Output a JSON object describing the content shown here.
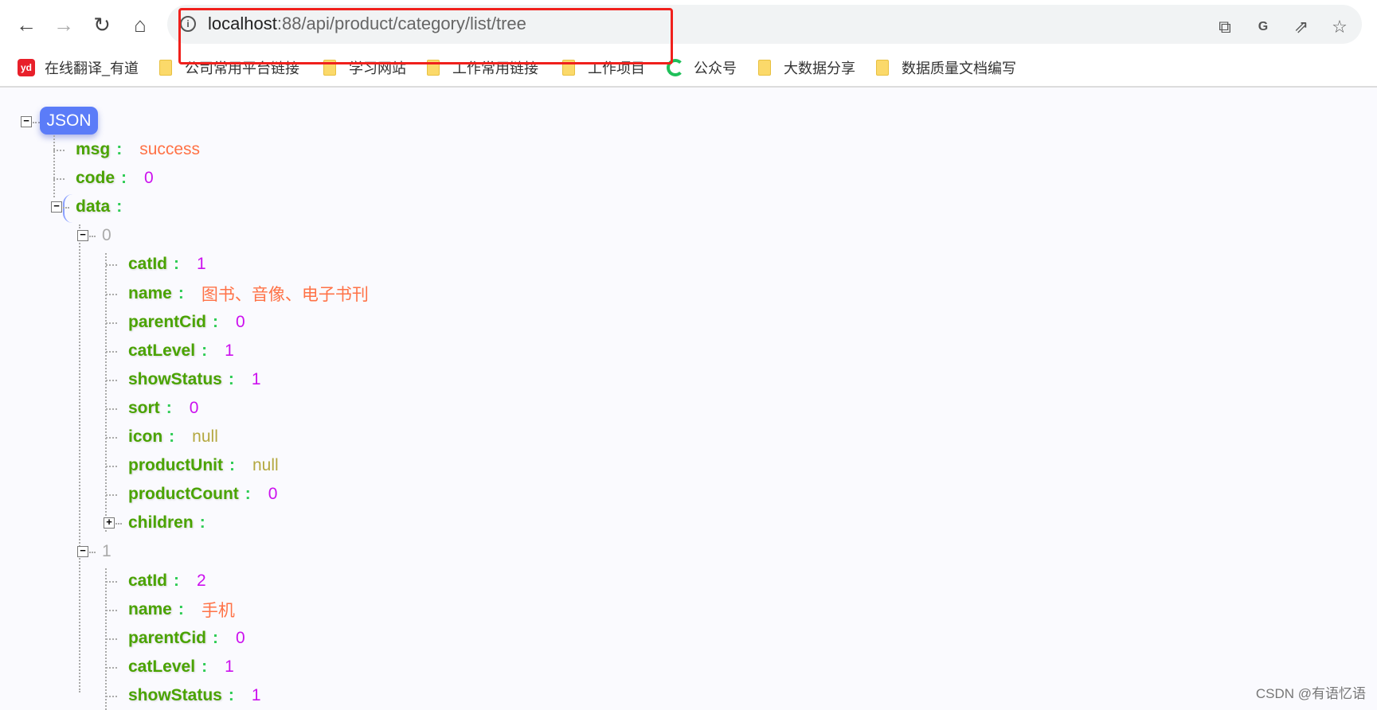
{
  "browser": {
    "url_host": "localhost",
    "url_path": ":88/api/product/category/list/tree",
    "bookmarks": [
      {
        "label": "在线翻译_有道",
        "icon": "youdao-icon"
      },
      {
        "label": "公司常用平台链接",
        "icon": "folder-icon"
      },
      {
        "label": "学习网站",
        "icon": "folder-icon"
      },
      {
        "label": "工作常用链接",
        "icon": "folder-icon"
      },
      {
        "label": "工作项目",
        "icon": "folder-icon"
      },
      {
        "label": "公众号",
        "icon": "wechat-icon"
      },
      {
        "label": "大数据分享",
        "icon": "folder-icon"
      },
      {
        "label": "数据质量文档编写",
        "icon": "folder-icon"
      }
    ]
  },
  "viewer": {
    "root_label": "JSON",
    "rows": [
      {
        "key": "msg",
        "value": "success",
        "type": "string",
        "depth": 0
      },
      {
        "key": "code",
        "value": "0",
        "type": "number",
        "depth": 0
      },
      {
        "key": "data",
        "value": "",
        "type": "object",
        "depth": 0,
        "toggle": "minus"
      },
      {
        "key": "0",
        "value": "",
        "type": "index",
        "depth": 1,
        "toggle": "minus"
      },
      {
        "key": "catId",
        "value": "1",
        "type": "number",
        "depth": 2
      },
      {
        "key": "name",
        "value": "图书、音像、电子书刊",
        "type": "string",
        "depth": 2
      },
      {
        "key": "parentCid",
        "value": "0",
        "type": "number",
        "depth": 2
      },
      {
        "key": "catLevel",
        "value": "1",
        "type": "number",
        "depth": 2
      },
      {
        "key": "showStatus",
        "value": "1",
        "type": "number",
        "depth": 2
      },
      {
        "key": "sort",
        "value": "0",
        "type": "number",
        "depth": 2
      },
      {
        "key": "icon",
        "value": "null",
        "type": "null",
        "depth": 2
      },
      {
        "key": "productUnit",
        "value": "null",
        "type": "null",
        "depth": 2
      },
      {
        "key": "productCount",
        "value": "0",
        "type": "number",
        "depth": 2
      },
      {
        "key": "children",
        "value": "",
        "type": "object",
        "depth": 2,
        "toggle": "plus"
      },
      {
        "key": "1",
        "value": "",
        "type": "index",
        "depth": 1,
        "toggle": "minus"
      },
      {
        "key": "catId",
        "value": "2",
        "type": "number",
        "depth": 2
      },
      {
        "key": "name",
        "value": "手机",
        "type": "string",
        "depth": 2
      },
      {
        "key": "parentCid",
        "value": "0",
        "type": "number",
        "depth": 2
      },
      {
        "key": "catLevel",
        "value": "1",
        "type": "number",
        "depth": 2
      },
      {
        "key": "showStatus",
        "value": "1",
        "type": "number",
        "depth": 2
      }
    ]
  },
  "watermark": "CSDN @有语忆语",
  "colors": {
    "key": "#4aa300",
    "number": "#cc11ee",
    "string": "#ff7246",
    "null": "#b4a840",
    "accent": "#5b7cf8",
    "highlight": "#f0201c"
  }
}
